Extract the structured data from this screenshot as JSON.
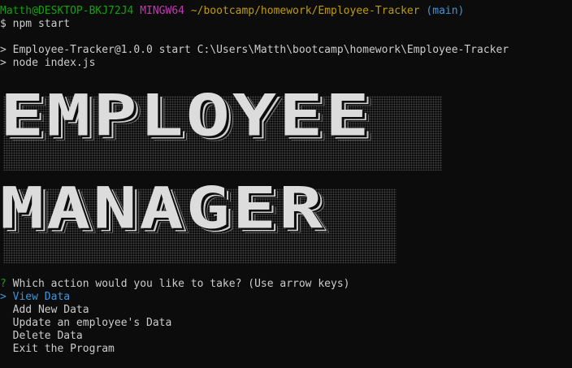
{
  "prompt": {
    "user_host": "Matth@DESKTOP-BKJ72J4",
    "shell": "MINGW64",
    "path": "~/bootcamp/homework/Employee-Tracker",
    "branch": "(main)",
    "symbol": "$",
    "command": "npm start"
  },
  "output": {
    "line1": "> Employee-Tracker@1.0.0 start C:\\Users\\Matth\\bootcamp\\homework\\Employee-Tracker",
    "line2": "> node index.js"
  },
  "banner": {
    "word1": "EMPLOYEE",
    "word2": "MANAGER"
  },
  "question": {
    "marker": "?",
    "text": "Which action would you like to take? (Use arrow keys)"
  },
  "menu": {
    "pointer": ">",
    "items": [
      "View Data",
      "Add New Data",
      "Update an employee's Data",
      "Delete Data",
      "Exit the Program"
    ]
  },
  "colors": {
    "background": "#0c0c0c",
    "prompt_user": "#13a10e",
    "prompt_shell": "#c239b3",
    "prompt_path": "#c19c00",
    "prompt_branch": "#3a96dd",
    "selected": "#3a96dd"
  }
}
